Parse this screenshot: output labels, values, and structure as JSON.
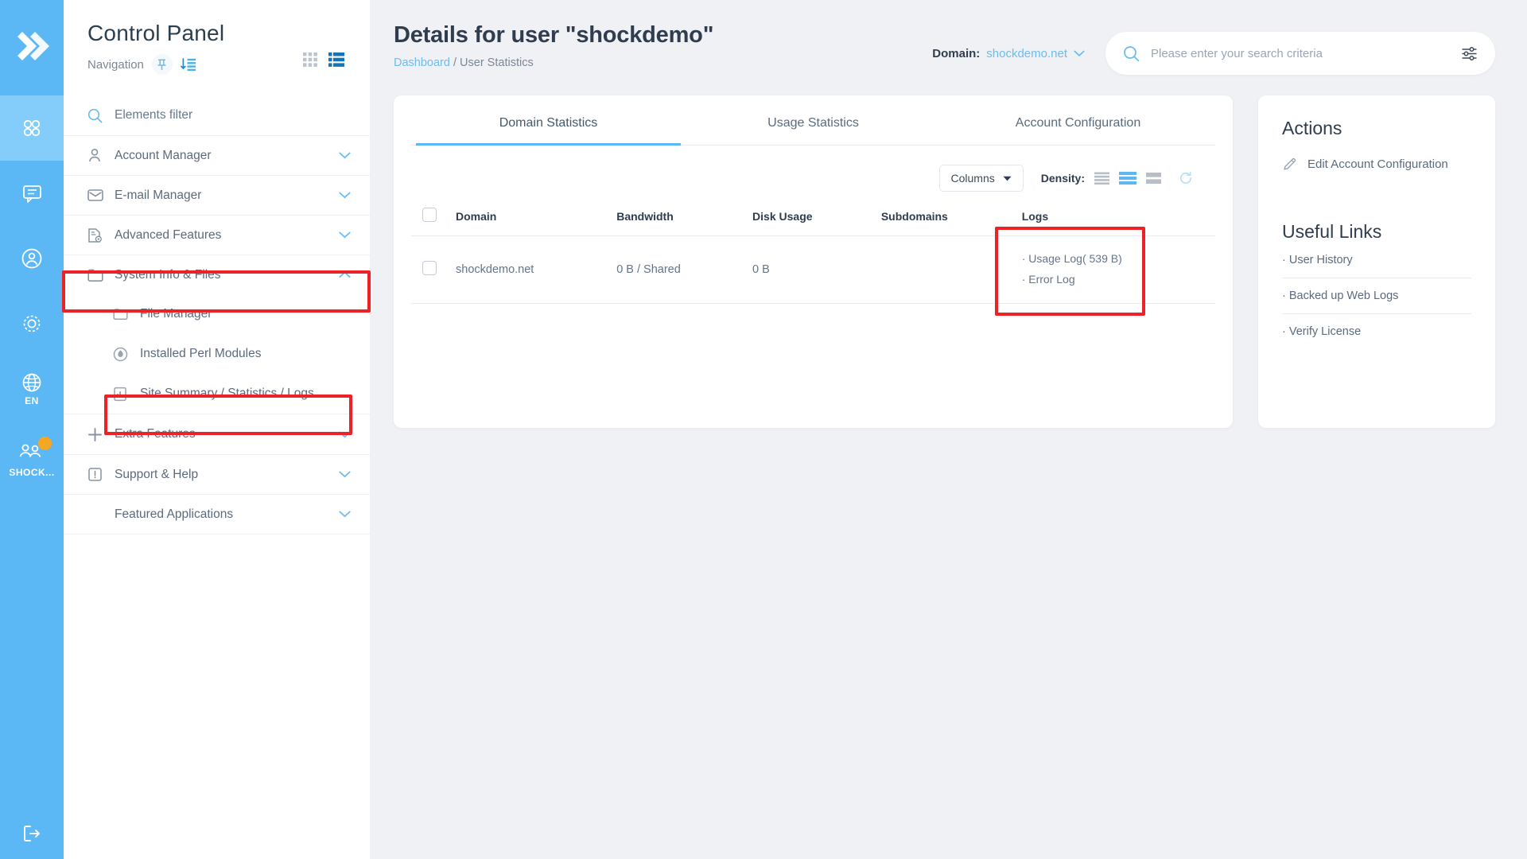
{
  "rail": {
    "logo_icon": "chevrons-right-logo",
    "items": [
      {
        "icon": "apps-grid-icon",
        "name": "apps",
        "label": "",
        "active": true
      },
      {
        "icon": "chat-bubble-icon",
        "name": "messages",
        "label": "",
        "active": false
      },
      {
        "icon": "user-circle-icon",
        "name": "profile",
        "label": "",
        "active": false
      },
      {
        "icon": "gear-icon",
        "name": "settings",
        "label": "",
        "active": false
      },
      {
        "icon": "globe-icon",
        "name": "language",
        "label": "EN",
        "active": false
      },
      {
        "icon": "users-icon",
        "name": "account",
        "label": "SHOCK...",
        "active": false,
        "badge": true
      }
    ],
    "logout_icon": "logout-icon"
  },
  "sidebar": {
    "title": "Control Panel",
    "nav_label": "Navigation",
    "pin_icon": "pin-icon",
    "sort_icon": "sort-list-icon",
    "view_grid_icon": "grid-view-icon",
    "view_list_icon": "list-view-icon",
    "items": [
      {
        "label": "Elements filter",
        "icon": "search-icon",
        "expandable": false
      },
      {
        "label": "Account Manager",
        "icon": "user-icon",
        "expandable": true,
        "expanded": false
      },
      {
        "label": "E-mail Manager",
        "icon": "envelope-icon",
        "expandable": true,
        "expanded": false
      },
      {
        "label": "Advanced Features",
        "icon": "document-gear-icon",
        "expandable": true,
        "expanded": false
      },
      {
        "label": "System Info & Files",
        "icon": "folder-icon",
        "expandable": true,
        "expanded": true
      },
      {
        "label": "Extra Features",
        "icon": "plus-icon",
        "expandable": true,
        "expanded": false
      },
      {
        "label": "Support & Help",
        "icon": "exclamation-box-icon",
        "expandable": true,
        "expanded": false
      },
      {
        "label": "Featured Applications",
        "icon": "",
        "expandable": true,
        "expanded": false
      }
    ],
    "subitems": [
      {
        "label": "File Manager",
        "icon": "folder-icon"
      },
      {
        "label": "Installed Perl Modules",
        "icon": "perl-icon"
      },
      {
        "label": "Site Summary / Statistics / Logs",
        "icon": "bar-chart-icon"
      }
    ]
  },
  "header": {
    "page_title": "Details for user \"shockdemo\"",
    "breadcrumb_link": "Dashboard",
    "breadcrumb_sep": "/",
    "breadcrumb_current": "User Statistics",
    "domain_label": "Domain:",
    "domain_value": "shockdemo.net",
    "domain_chevron_icon": "chevron-down-icon",
    "search_icon": "search-icon",
    "search_value": "",
    "search_placeholder": "Please enter your search criteria",
    "search_filter_icon": "sliders-icon"
  },
  "tabs": [
    {
      "label": "Domain Statistics",
      "active": true
    },
    {
      "label": "Usage Statistics",
      "active": false
    },
    {
      "label": "Account Configuration",
      "active": false
    }
  ],
  "toolbar": {
    "columns_label": "Columns",
    "columns_chevron_icon": "chevron-down-icon",
    "density_label": "Density:",
    "density_compact_icon": "density-compact-icon",
    "density_standard_icon": "density-standard-icon",
    "density_comfortable_icon": "density-comfortable-icon",
    "refresh_icon": "refresh-icon",
    "active_density": "standard"
  },
  "table": {
    "columns": [
      "Domain",
      "Bandwidth",
      "Disk Usage",
      "Subdomains",
      "Logs"
    ],
    "rows": [
      {
        "domain": "shockdemo.net",
        "bandwidth": "0 B / Shared",
        "disk_usage": "0 B",
        "subdomains": "",
        "logs": [
          "Usage Log( 539 B)",
          "Error Log"
        ]
      }
    ]
  },
  "actions_panel": {
    "title": "Actions",
    "items": [
      {
        "label": "Edit Account Configuration",
        "icon": "pencil-icon"
      }
    ]
  },
  "useful_links_panel": {
    "title": "Useful Links",
    "items": [
      "User History",
      "Backed up Web Logs",
      "Verify License"
    ]
  },
  "colors": {
    "brand_blue": "#5cb8f5",
    "rail_blue": "#5cb8f5",
    "page_bg": "#f0f1f5",
    "accent_orange": "#f5a623",
    "highlight_red": "#ec2227",
    "text_dark": "#2f3d4e",
    "text_muted": "#5b6b7d"
  }
}
